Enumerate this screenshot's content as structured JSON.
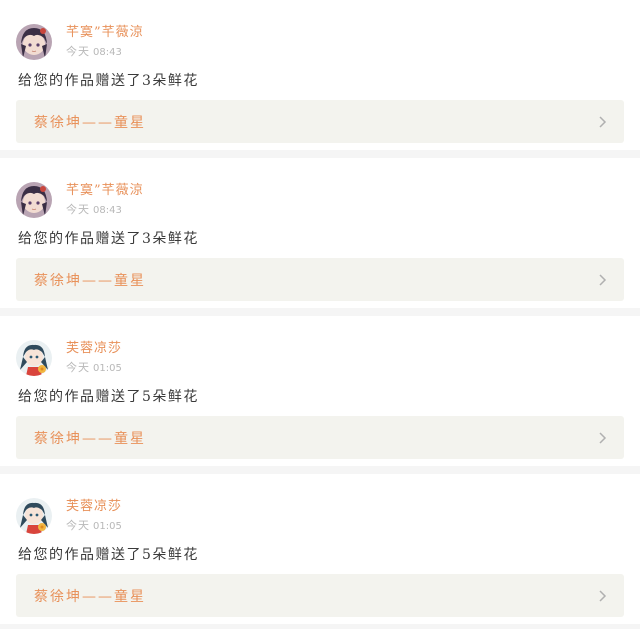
{
  "feed": {
    "items": [
      {
        "username": "芊寞”芊薇涼",
        "time_prefix": "今天",
        "time": "08:43",
        "message": "给您的作品赠送了3朵鲜花",
        "work_title": "蔡徐坤——童星",
        "avatar": "avatar-dark-hair"
      },
      {
        "username": "芊寞”芊薇涼",
        "time_prefix": "今天",
        "time": "08:43",
        "message": "给您的作品赠送了3朵鲜花",
        "work_title": "蔡徐坤——童星",
        "avatar": "avatar-dark-hair"
      },
      {
        "username": "芙蓉凉莎",
        "time_prefix": "今天",
        "time": "01:05",
        "message": "给您的作品赠送了5朵鲜花",
        "work_title": "蔡徐坤——童星",
        "avatar": "avatar-anime-girl"
      },
      {
        "username": "芙蓉凉莎",
        "time_prefix": "今天",
        "time": "01:05",
        "message": "给您的作品赠送了5朵鲜花",
        "work_title": "蔡徐坤——童星",
        "avatar": "avatar-anime-girl"
      }
    ]
  },
  "colors": {
    "accent": "#e8915a",
    "link_bg": "#f3f3ee",
    "muted": "#b8b8b8"
  }
}
